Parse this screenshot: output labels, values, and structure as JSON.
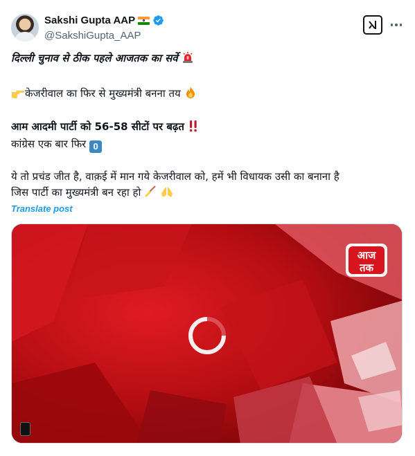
{
  "author": {
    "display_name": "Sakshi Gupta AAP",
    "handle": "@SakshiGupta_AAP",
    "flag_icon": "india-flag-icon",
    "verified_color": "#1d9bf0"
  },
  "header_actions": {
    "grok_icon": "grok-icon",
    "more_icon": "more-options-icon"
  },
  "post": {
    "line1": "दिल्ली चुनाव से ठीक पहले आजतक का सर्वे",
    "line2": "केजरीवाल का फिर से मुख्यमंत्री बनना तय",
    "line3": "आम आदमी पार्टी को 56-58 सीटों पर बढ़त",
    "line4": "कांग्रेस एक बार फिर",
    "line4_keycap": "0",
    "line5": "ये तो प्रचंड जीत है, वाक़ई में मान गये केजरीवाल को,  हमें भी विधायक उसी का बनाना है",
    "line6": "जिस पार्टी का मुख्यमंत्री बन रहा हो"
  },
  "translate_label": "Translate post",
  "media": {
    "logo_text_top": "आज",
    "logo_text_bottom": "तक",
    "accent_color": "#c4101a"
  }
}
